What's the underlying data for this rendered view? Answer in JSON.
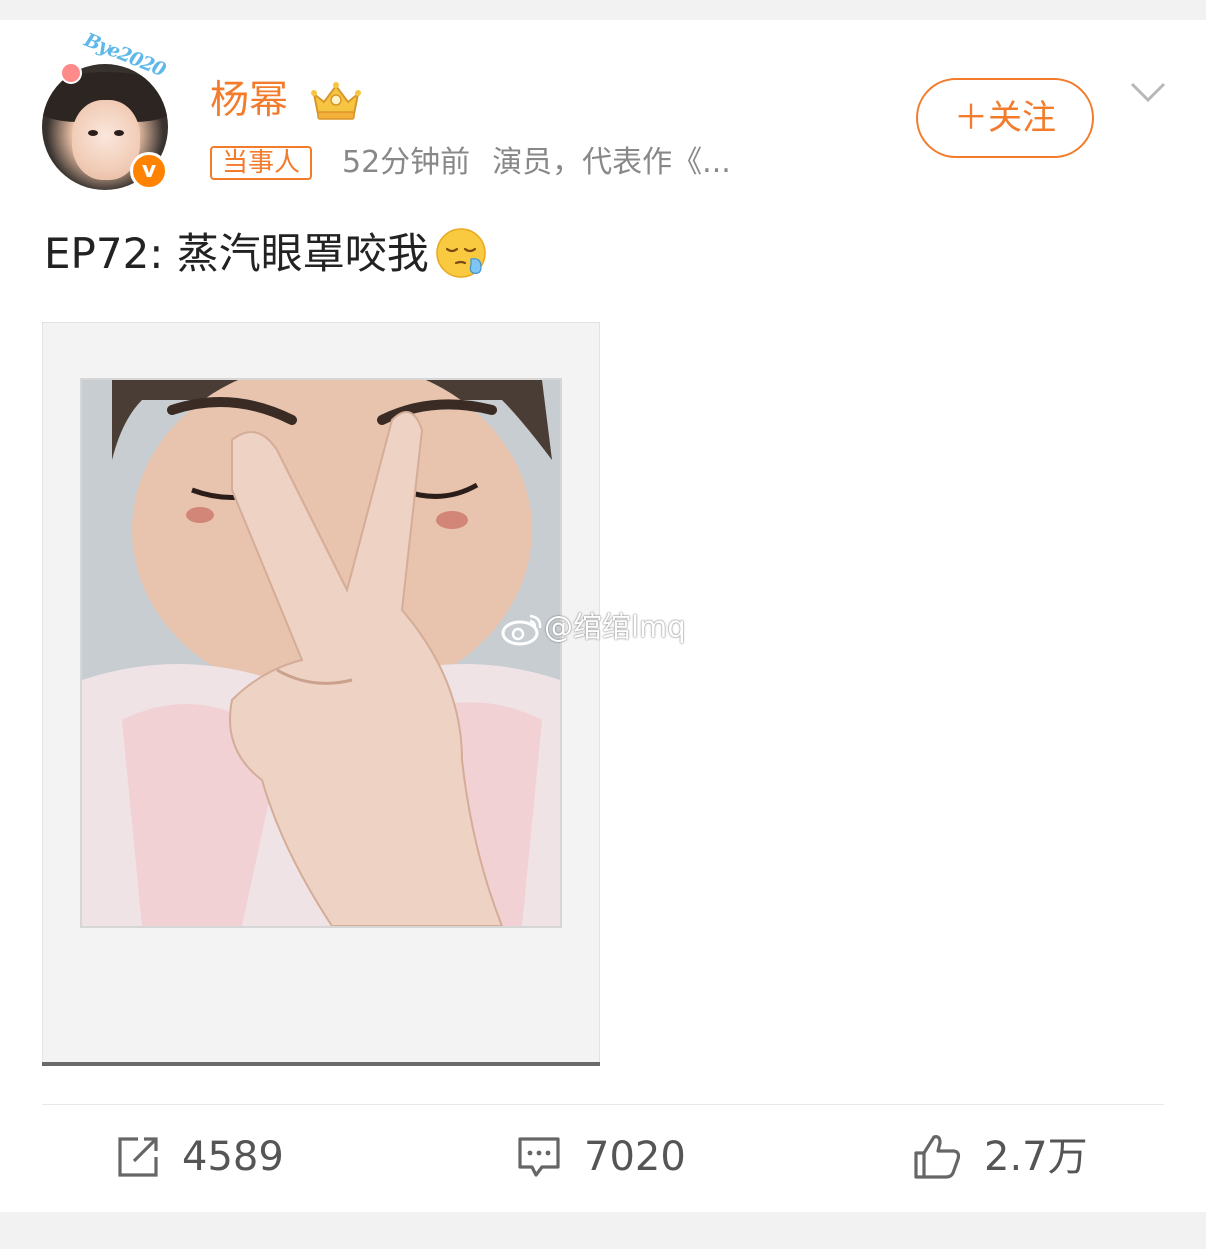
{
  "post": {
    "author": "杨幂",
    "tag": "当事人",
    "time": "52分钟前",
    "bio": "演员，代表作《...",
    "follow_label": "＋关注",
    "text": "EP72: 蒸汽眼罩咬我",
    "avatar_badge": "Bye2020",
    "verified_mark": "v",
    "watermark": "@绾绾lmq"
  },
  "actions": {
    "repost_count": "4589",
    "comment_count": "7020",
    "like_count": "2.7万"
  },
  "colors": {
    "accent": "#f37c2c",
    "verified": "#ff8200",
    "text": "#222222",
    "muted": "#888888"
  },
  "icons": {
    "repost": "share-icon",
    "comment": "comment-icon",
    "like": "thumbs-up-icon",
    "more": "chevron-down-icon",
    "crown": "crown-icon",
    "emoji": "sleepy-face-emoji"
  }
}
